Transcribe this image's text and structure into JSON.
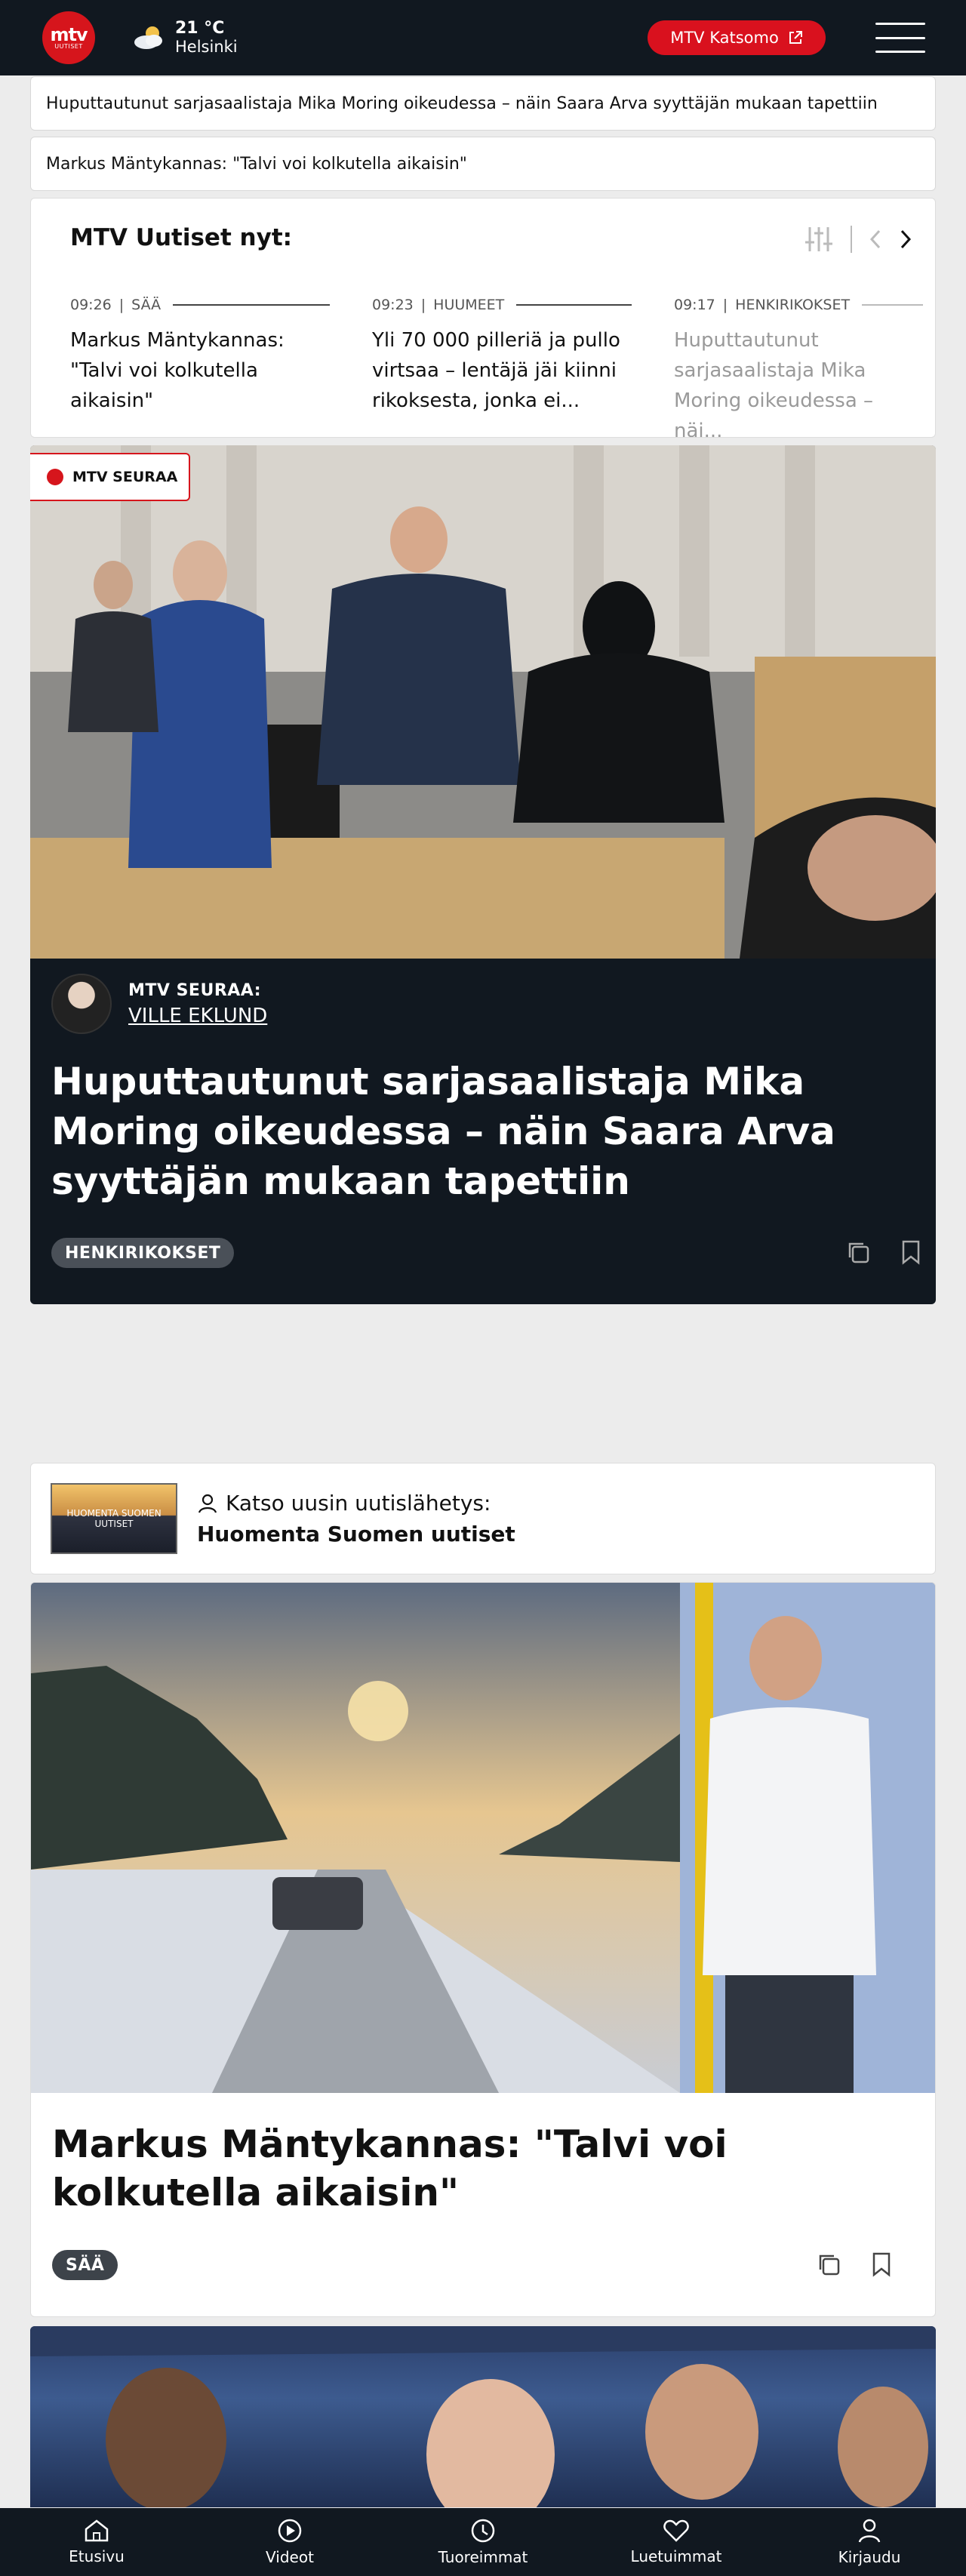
{
  "header": {
    "logo_line1": "mtv",
    "logo_line2": "UUTISET",
    "weather_temp": "21 °C",
    "weather_city": "Helsinki",
    "katsomo_label": "MTV Katsomo"
  },
  "link_cards": [
    "Huputtautunut sarjasaalistaja Mika Moring oikeudessa – näin Saara Arva syyttäjän mukaan tapettiin",
    "Markus Mäntykannas: \"Talvi voi kolkutella aikaisin\""
  ],
  "news_now": {
    "title": "MTV Uutiset nyt:",
    "items": [
      {
        "time": "09:26",
        "category": "SÄÄ",
        "headline": "Markus Mäntykannas: \"Talvi voi kolkutella aikaisin\""
      },
      {
        "time": "09:23",
        "category": "HUUMEET",
        "headline": "Yli 70 000 pilleriä ja pullo virtsaa – lentäjä jäi kiinni rikoksesta, jonka ei..."
      },
      {
        "time": "09:17",
        "category": "HENKIRIKOKSET",
        "headline": "Huputtautunut sarjasaalistaja Mika Moring oikeudessa – näi..."
      }
    ]
  },
  "hero": {
    "badge": "MTV SEURAA",
    "author_label": "MTV SEURAA:",
    "author_name": "VILLE EKLUND",
    "title": "Huputtautunut sarjasaalistaja Mika Moring oikeudessa – näin Saara Arva syyttäjän mukaan tapettiin",
    "tag": "HENKIRIKOKSET"
  },
  "video_strip": {
    "thumb_text": "HUOMENTA SUOMEN UUTISET",
    "line1": "Katso uusin uutislähetys:",
    "line2": "Huomenta Suomen uutiset"
  },
  "article2": {
    "title": "Markus Mäntykannas: \"Talvi voi kolkutella aikaisin\"",
    "tag": "SÄÄ"
  },
  "bottom_nav": [
    {
      "label": "Etusivu",
      "icon": "home-icon"
    },
    {
      "label": "Videot",
      "icon": "play-icon"
    },
    {
      "label": "Tuoreimmat",
      "icon": "clock-icon"
    },
    {
      "label": "Luetuimmat",
      "icon": "heart-icon"
    },
    {
      "label": "Kirjaudu",
      "icon": "user-icon"
    }
  ],
  "colors": {
    "brand_red": "#d6151c",
    "dark_bg": "#111820"
  }
}
